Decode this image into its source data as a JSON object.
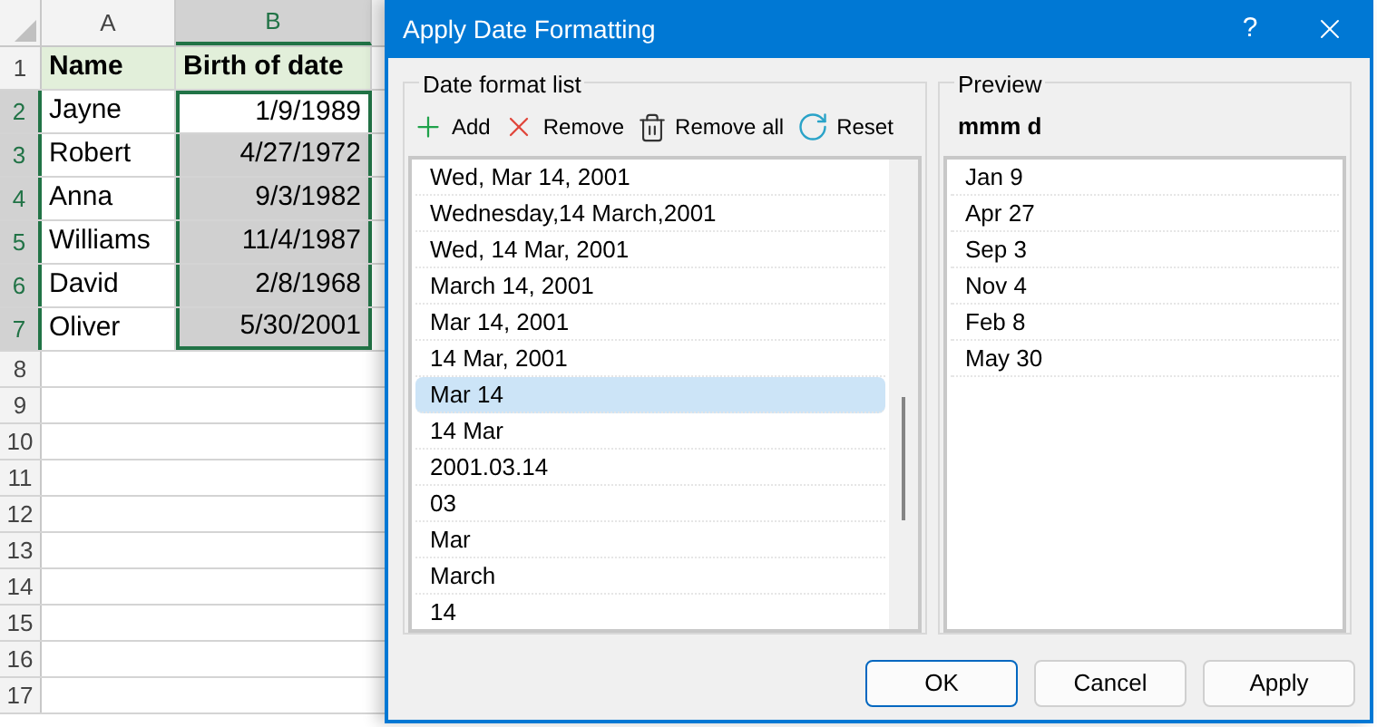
{
  "sheet": {
    "columns": [
      {
        "label": "A",
        "selected": false
      },
      {
        "label": "B",
        "selected": true
      }
    ],
    "header_row": {
      "number": "1",
      "cells": [
        "Name",
        "Birth of date"
      ]
    },
    "rows": [
      {
        "number": "2",
        "name": "Jayne",
        "date": "1/9/1989",
        "selected": true,
        "active": true
      },
      {
        "number": "3",
        "name": "Robert",
        "date": "4/27/1972",
        "selected": true,
        "active": false
      },
      {
        "number": "4",
        "name": "Anna",
        "date": "9/3/1982",
        "selected": true,
        "active": false
      },
      {
        "number": "5",
        "name": "Williams",
        "date": "11/4/1987",
        "selected": true,
        "active": false
      },
      {
        "number": "6",
        "name": "David",
        "date": "2/8/1968",
        "selected": true,
        "active": false
      },
      {
        "number": "7",
        "name": "Oliver",
        "date": "5/30/2001",
        "selected": true,
        "active": false
      }
    ],
    "empty_rows": [
      "8",
      "9",
      "10",
      "11",
      "12",
      "13",
      "14",
      "15",
      "16",
      "17"
    ]
  },
  "dialog": {
    "title": "Apply Date Formatting",
    "help": "?",
    "format_group": {
      "title": "Date format list",
      "toolbar": [
        {
          "kind": "add",
          "label": "Add"
        },
        {
          "kind": "remove",
          "label": "Remove"
        },
        {
          "kind": "remove_all",
          "label": "Remove all"
        },
        {
          "kind": "reset",
          "label": "Reset"
        }
      ],
      "formats": [
        {
          "label": "Wed, Mar 14, 2001",
          "selected": false
        },
        {
          "label": "Wednesday,14 March,2001",
          "selected": false
        },
        {
          "label": "Wed, 14 Mar, 2001",
          "selected": false
        },
        {
          "label": "March 14, 2001",
          "selected": false
        },
        {
          "label": "Mar 14, 2001",
          "selected": false
        },
        {
          "label": "14 Mar, 2001",
          "selected": false
        },
        {
          "label": "Mar 14",
          "selected": true
        },
        {
          "label": "14 Mar",
          "selected": false
        },
        {
          "label": "2001.03.14",
          "selected": false
        },
        {
          "label": "03",
          "selected": false
        },
        {
          "label": "Mar",
          "selected": false
        },
        {
          "label": "March",
          "selected": false
        },
        {
          "label": "14",
          "selected": false
        }
      ]
    },
    "preview": {
      "title": "Preview",
      "format": "mmm d",
      "values": [
        "Jan 9",
        "Apr 27",
        "Sep 3",
        "Nov 4",
        "Feb 8",
        "May 30"
      ]
    },
    "buttons": [
      {
        "label": "OK",
        "default": true
      },
      {
        "label": "Cancel",
        "default": false
      },
      {
        "label": "Apply",
        "default": false
      }
    ]
  }
}
